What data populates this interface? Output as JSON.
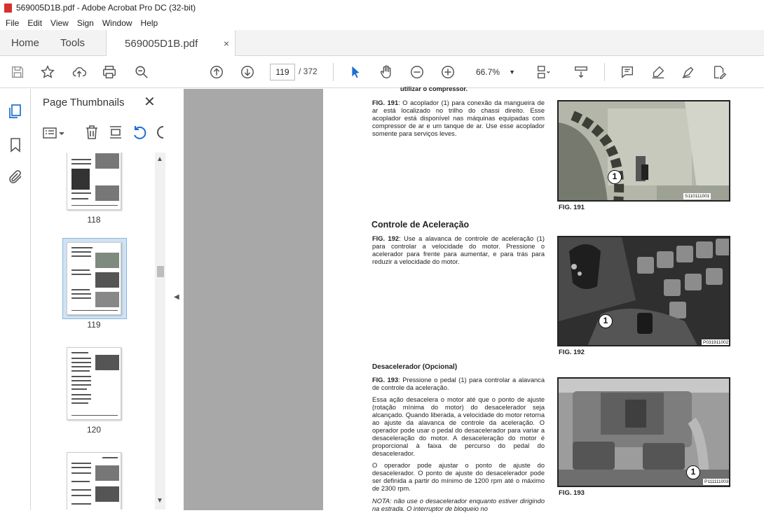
{
  "window": {
    "title": "569005D1B.pdf - Adobe Acrobat Pro DC (32-bit)"
  },
  "menu": [
    "File",
    "Edit",
    "View",
    "Sign",
    "Window",
    "Help"
  ],
  "tabs": {
    "home": "Home",
    "tools": "Tools",
    "document": "569005D1B.pdf",
    "close": "×"
  },
  "toolbar": {
    "current_page": "119",
    "total_pages": "/ 372",
    "zoom": "66.7%"
  },
  "panel": {
    "title": "Page Thumbnails",
    "close": "✕",
    "thumbnails": [
      {
        "label": "118"
      },
      {
        "label": "119",
        "selected": true
      },
      {
        "label": "120"
      },
      {
        "label": ""
      }
    ]
  },
  "page": {
    "top_cut": "utilizar o compressor.",
    "fig191_label": "FIG. 191",
    "fig191_text": ": O acoplador (1) para conexão da mangueira de ar está localizado no trilho do chassi direito. Esse acoplador está disponível nas máquinas equipadas com compressor de ar e um tanque de ar. Use esse acoplador somente para serviços leves.",
    "fig191_caption": "FIG. 191",
    "fig191_code": "S110111001",
    "heading_accel": "Controle de Aceleração",
    "fig192_label": "FIG. 192",
    "fig192_text": ": Use a alavanca de controle de aceleração (1) para controlar a velocidade do motor. Pressione o acelerador para frente para aumentar, e para trás para reduzir a velocidade do motor.",
    "fig192_caption": "FIG. 192",
    "fig192_code": "P031911002",
    "heading_decel": "Desacelerador (Opcional)",
    "fig193_label": "FIG. 193",
    "fig193_text": ": Pressione o pedal (1) para controlar a alavanca de controle da aceleração.",
    "decel_para1": "Essa ação desacelera o motor até que o ponto de ajuste (rotação mínima do motor) do desacelerador seja alcançado. Quando liberada, a velocidade do motor retorna ao ajuste da alavanca de controle da aceleração. O operador pode usar o pedal do desacelerador para variar a desaceleração do motor. A desaceleração do motor é proporcional à faixa de percurso do pedal do desacelerador.",
    "decel_para2": "O operador pode ajustar o ponto de ajuste do desacelerador. O ponto de ajuste do desacelerador pode ser definida a partir do mínimo de 1200 rpm até o máximo de 2300 rpm.",
    "note": "NOTA: não use o desacelerador enquanto estiver dirigindo na estrada. O interruptor de bloqueio no",
    "fig193_caption": "FIG. 193",
    "fig193_code": "P111111003",
    "callout": "1"
  }
}
